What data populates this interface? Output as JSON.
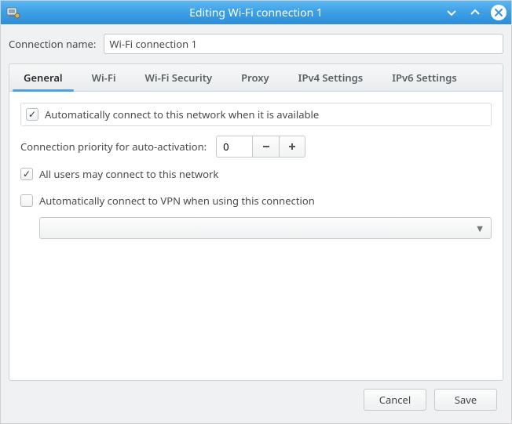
{
  "window": {
    "title": "Editing Wi-Fi connection 1"
  },
  "connection_name": {
    "label": "Connection name:",
    "value": "Wi-Fi connection 1"
  },
  "tabs": {
    "general": "General",
    "wifi": "Wi-Fi",
    "wifi_security": "Wi-Fi Security",
    "proxy": "Proxy",
    "ipv4": "IPv4 Settings",
    "ipv6": "IPv6 Settings",
    "active": "general"
  },
  "general": {
    "auto_connect": {
      "label": "Automatically connect to this network when it is available",
      "checked": true
    },
    "priority": {
      "label": "Connection priority for auto-activation:",
      "value": "0"
    },
    "all_users": {
      "label": "All users may connect to this network",
      "checked": true
    },
    "auto_vpn": {
      "label": "Automatically connect to VPN when using this connection",
      "checked": false
    },
    "vpn_select": {
      "value": ""
    }
  },
  "buttons": {
    "cancel": "Cancel",
    "save": "Save"
  }
}
